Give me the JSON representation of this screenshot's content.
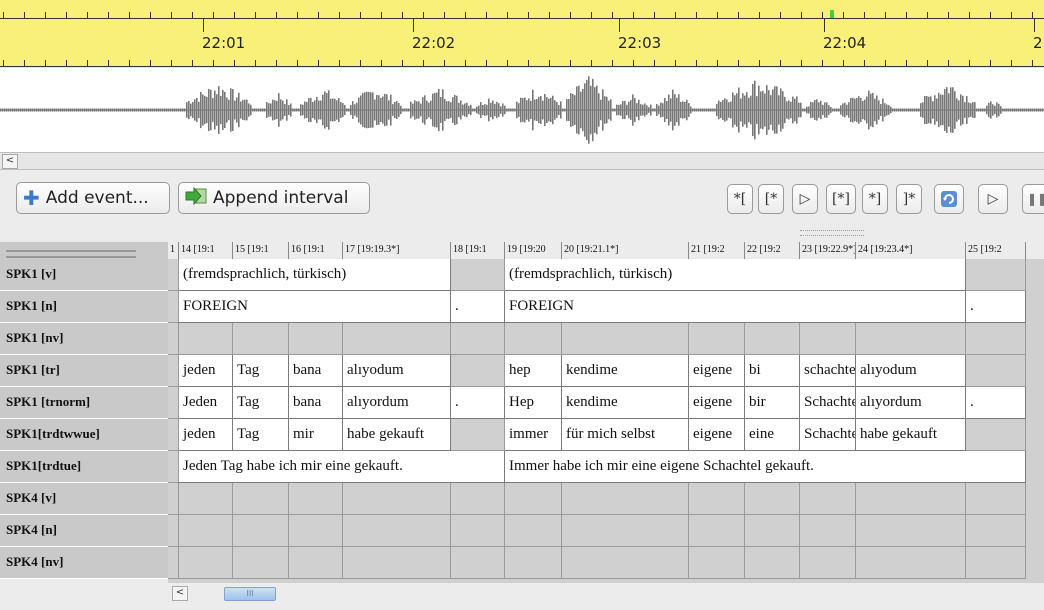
{
  "timeline": {
    "labels": [
      "22:01",
      "22:02",
      "22:03",
      "22:04",
      "2"
    ]
  },
  "toolbar": {
    "add_event_label": "Add event...",
    "append_interval_label": "Append interval",
    "selection_buttons": [
      "*[",
      "[*",
      "▷",
      "[*]",
      "*]",
      "]*"
    ],
    "play_icon": "▷"
  },
  "columns": [
    {
      "label": "1"
    },
    {
      "label": "14 [19:1"
    },
    {
      "label": "15 [19:1"
    },
    {
      "label": "16 [19:1"
    },
    {
      "label": "17 [19:19.3*]"
    },
    {
      "label": "18 [19:1"
    },
    {
      "label": "19 [19:20"
    },
    {
      "label": "20 [19:21.1*]"
    },
    {
      "label": "21 [19:2"
    },
    {
      "label": "22 [19:2"
    },
    {
      "label": "23 [19:22.9*]"
    },
    {
      "label": "24 [19:23.4*]"
    },
    {
      "label": "25 [19:2"
    }
  ],
  "tiers": [
    {
      "label": "SPK1 [v]"
    },
    {
      "label": "SPK1 [n]"
    },
    {
      "label": "SPK1 [nv]"
    },
    {
      "label": "SPK1 [tr]"
    },
    {
      "label": "SPK1 [trnorm]"
    },
    {
      "label": "SPK1[trdtwwue]"
    },
    {
      "label": "SPK1[trdtue]"
    },
    {
      "label": "SPK4 [v]"
    },
    {
      "label": "SPK4 [n]"
    },
    {
      "label": "SPK4 [nv]"
    }
  ],
  "cells": {
    "v1": "(fremdsprachlich, türkisch)",
    "v2": "(fremdsprachlich, türkisch)",
    "n1": "FOREIGN",
    "n_dot1": ".",
    "n2": "FOREIGN",
    "n_dot2": ".",
    "tr": [
      "jeden",
      "Tag",
      "bana",
      "alıyodum",
      "",
      "hep",
      "kendime",
      "eigene",
      "bi",
      "schachtel",
      "alıyodum"
    ],
    "trnorm": [
      "Jeden",
      "Tag",
      "bana",
      "alıyordum",
      ".",
      "Hep",
      "kendime",
      "eigene",
      "bir",
      "Schachtel",
      "alıyordum",
      "."
    ],
    "trdtwwue": [
      "jeden",
      "Tag",
      "mir",
      "habe gekauft",
      "",
      "immer",
      "für mich selbst",
      "eigene",
      "eine",
      "Schachtel",
      "habe gekauft"
    ],
    "trdtue1": "Jeden Tag habe ich mir eine gekauft.",
    "trdtue2": "Immer habe ich mir eine eigene Schachtel gekauft."
  },
  "scrollbar": {
    "left_arrow": "<",
    "thumb_grip": "III"
  }
}
